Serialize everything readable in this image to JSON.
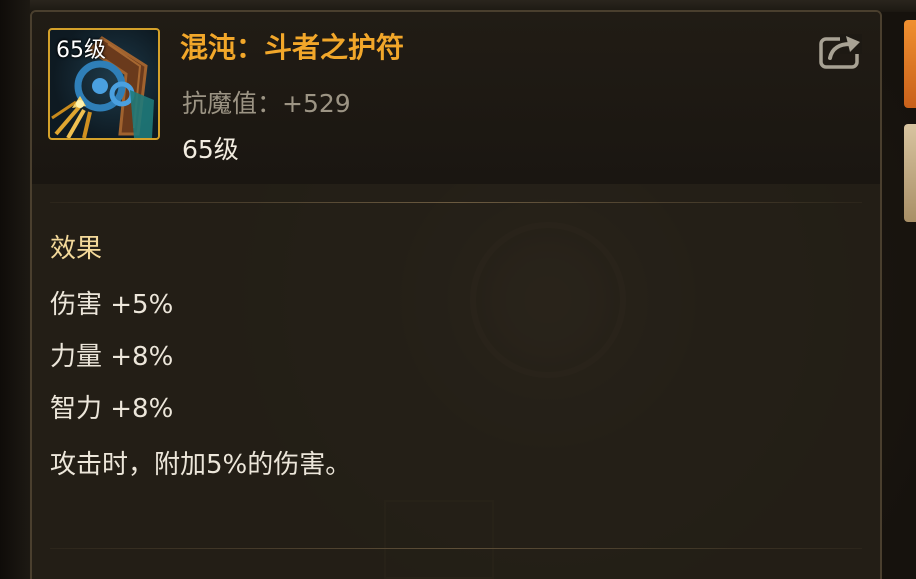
{
  "item": {
    "icon_name": "amulet-icon",
    "icon_level_badge": "65级",
    "name": "混沌：斗者之护符",
    "stat": "抗魔值：+529",
    "level": "65级",
    "name_color": "#f2a72a",
    "frame_color": "#d4a12a"
  },
  "share": {
    "icon_name": "share-icon"
  },
  "effects": {
    "title": "效果",
    "lines": [
      "伤害 +5%",
      "力量 +8%",
      "智力 +8%",
      "攻击时，附加5%的伤害。"
    ]
  }
}
